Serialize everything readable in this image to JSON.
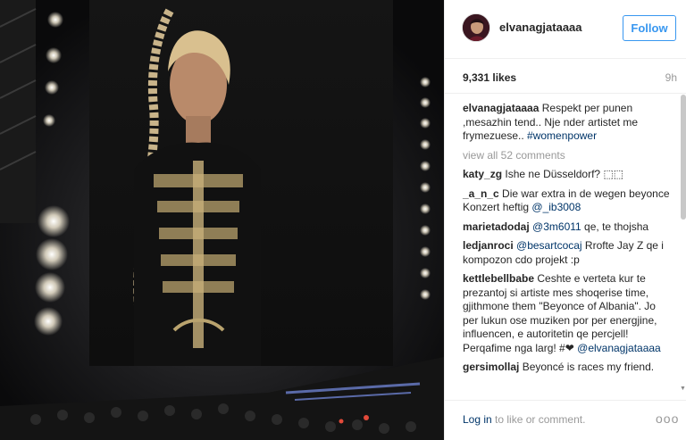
{
  "post": {
    "username": "elvanagjataaaa",
    "follow_label": "Follow",
    "likes": "9,331 likes",
    "time": "9h",
    "caption": {
      "user": "elvanagjataaaa",
      "text": "Respekt per punen ,mesazhin tend.. Nje nder artistet me frymezuese..",
      "hashtag": "#womenpower"
    },
    "view_all": "view all 52 comments",
    "comments": [
      {
        "user": "katy_zg",
        "text": "Ishe ne Düsseldorf? ⬚⬚"
      },
      {
        "user": "_a_n_c",
        "text": "Die war extra in de wegen beyonce Konzert heftig",
        "mention": "@_ib3008"
      },
      {
        "user": "marietadodaj",
        "mention": "@3m6011",
        "text": "qe, te thojsha"
      },
      {
        "user": "ledjanroci",
        "mention": "@besartcocaj",
        "text": "Rrofte Jay Z qe i kompozon cdo projekt :p"
      },
      {
        "user": "kettlebellbabe",
        "text": "Ceshte e verteta kur te prezantoj si artiste mes shoqerise time, gjithmone them \"Beyonce of Albania\". Jo per lukun ose muziken por per energjine, influencen, e autoritetin qe percjell! Perqafime nga larg! #❤",
        "mention": "@elvanagjataaaa"
      },
      {
        "user": "gersimollaj",
        "text": "Beyoncé is races my friend."
      }
    ],
    "footer": {
      "login": "Log in",
      "rest": " to like or comment.",
      "more": "ooo"
    }
  }
}
